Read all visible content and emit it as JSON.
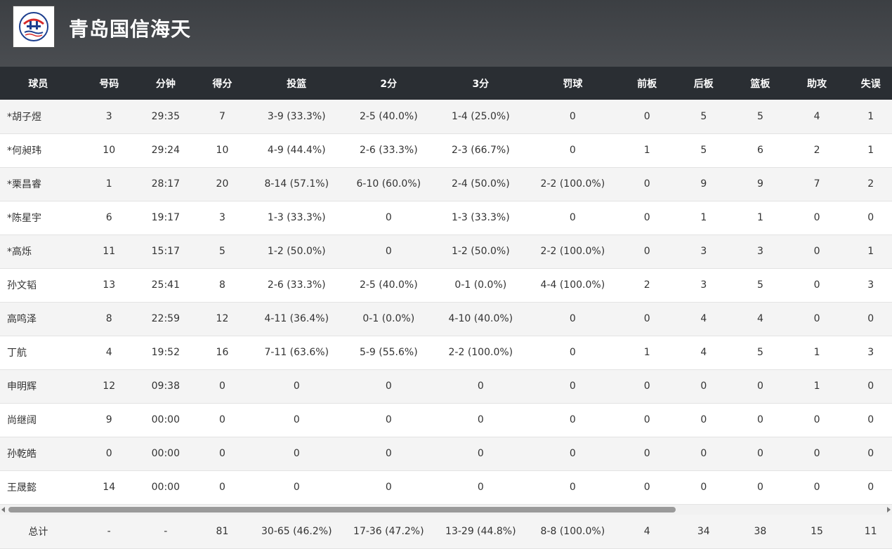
{
  "team": {
    "name": "青岛国信海天",
    "logo_icon": "qingdao-team-logo"
  },
  "columns": [
    "球员",
    "号码",
    "分钟",
    "得分",
    "投篮",
    "2分",
    "3分",
    "罚球",
    "前板",
    "后板",
    "篮板",
    "助攻",
    "失误"
  ],
  "players": [
    [
      "*胡子煜",
      "3",
      "29:35",
      "7",
      "3-9 (33.3%)",
      "2-5 (40.0%)",
      "1-4 (25.0%)",
      "0",
      "0",
      "5",
      "5",
      "4",
      "1"
    ],
    [
      "*何昶玮",
      "10",
      "29:24",
      "10",
      "4-9 (44.4%)",
      "2-6 (33.3%)",
      "2-3 (66.7%)",
      "0",
      "1",
      "5",
      "6",
      "2",
      "1"
    ],
    [
      "*栗昌睿",
      "1",
      "28:17",
      "20",
      "8-14 (57.1%)",
      "6-10 (60.0%)",
      "2-4 (50.0%)",
      "2-2 (100.0%)",
      "0",
      "9",
      "9",
      "7",
      "2"
    ],
    [
      "*陈星宇",
      "6",
      "19:17",
      "3",
      "1-3 (33.3%)",
      "0",
      "1-3 (33.3%)",
      "0",
      "0",
      "1",
      "1",
      "0",
      "0"
    ],
    [
      " *高烁",
      "11",
      "15:17",
      "5",
      "1-2 (50.0%)",
      "0",
      "1-2 (50.0%)",
      "2-2 (100.0%)",
      "0",
      "3",
      "3",
      "0",
      "1"
    ],
    [
      "孙文韬",
      "13",
      "25:41",
      "8",
      "2-6 (33.3%)",
      "2-5 (40.0%)",
      "0-1 (0.0%)",
      "4-4 (100.0%)",
      "2",
      "3",
      "5",
      "0",
      "3"
    ],
    [
      "高鸣泽",
      "8",
      "22:59",
      "12",
      "4-11 (36.4%)",
      "0-1 (0.0%)",
      "4-10 (40.0%)",
      "0",
      "0",
      "4",
      "4",
      "0",
      "0"
    ],
    [
      " 丁航",
      "4",
      "19:52",
      "16",
      "7-11 (63.6%)",
      "5-9 (55.6%)",
      "2-2 (100.0%)",
      "0",
      "1",
      "4",
      "5",
      "1",
      "3"
    ],
    [
      "申明辉",
      "12",
      "09:38",
      "0",
      "0",
      "0",
      "0",
      "0",
      "0",
      "0",
      "0",
      "1",
      "0"
    ],
    [
      "尚继阔",
      "9",
      "00:00",
      "0",
      "0",
      "0",
      "0",
      "0",
      "0",
      "0",
      "0",
      "0",
      "0"
    ],
    [
      "孙乾皓",
      "0",
      "00:00",
      "0",
      "0",
      "0",
      "0",
      "0",
      "0",
      "0",
      "0",
      "0",
      "0"
    ],
    [
      "王晟懿",
      "14",
      "00:00",
      "0",
      "0",
      "0",
      "0",
      "0",
      "0",
      "0",
      "0",
      "0",
      "0"
    ]
  ],
  "totals": [
    "总计",
    "-",
    "-",
    "81",
    "30-65 (46.2%)",
    "17-36 (47.2%)",
    "13-29 (44.8%)",
    "8-8 (100.0%)",
    "4",
    "34",
    "38",
    "15",
    "11"
  ],
  "colors": {
    "header_bg": "#45484c",
    "table_head_bg": "#2a2e33",
    "row_alt_bg": "#f4f4f4",
    "total_bg": "#f2f4f9"
  }
}
